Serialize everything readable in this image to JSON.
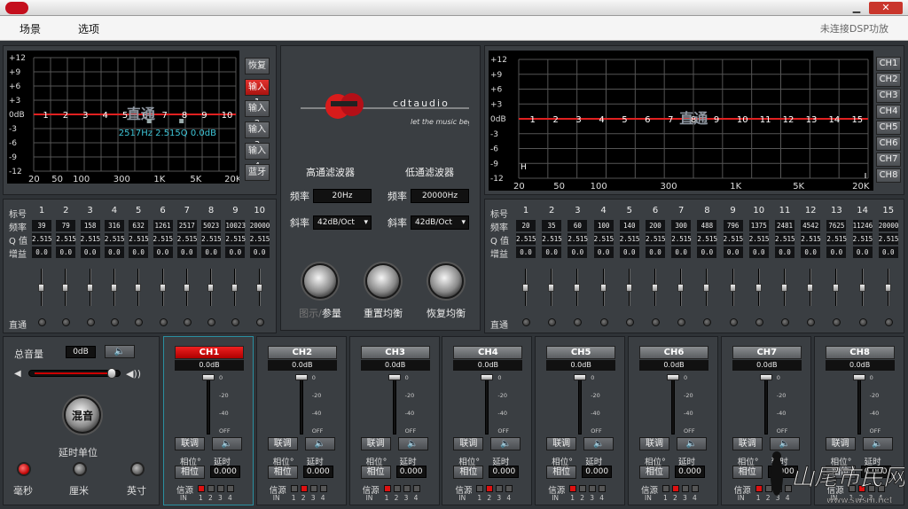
{
  "menu": {
    "items": [
      "场景",
      "选项"
    ],
    "status": "未连接DSP功放"
  },
  "eq_left": {
    "y_labels": [
      "+12",
      "+9",
      "+6",
      "+3",
      "0dB",
      "-3",
      "-6",
      "-9",
      "-12"
    ],
    "x_labels": [
      "20",
      "50",
      "100",
      "300",
      "1K",
      "5K",
      "20K"
    ],
    "band_markers": [
      "1",
      "2",
      "3",
      "4",
      "5",
      "6",
      "7",
      "8",
      "9",
      "10"
    ],
    "bypass_overlay": "直通",
    "readout": "2517Hz 2.515Q 0.0dB",
    "side_buttons": [
      "恢复",
      "输入1",
      "输入2",
      "输入3",
      "输入4",
      "蓝牙"
    ],
    "active_side": 1,
    "row_labels": [
      "标号",
      "频率",
      "Q 值",
      "增益"
    ],
    "bands": [
      "1",
      "2",
      "3",
      "4",
      "5",
      "6",
      "7",
      "8",
      "9",
      "10"
    ],
    "freqs": [
      "39",
      "79",
      "158",
      "316",
      "632",
      "1261",
      "2517",
      "5023",
      "10023",
      "20000"
    ],
    "q": [
      "2.515",
      "2.515",
      "2.515",
      "2.515",
      "2.515",
      "2.515",
      "2.515",
      "2.515",
      "2.515",
      "2.515"
    ],
    "gain": [
      "0.0",
      "0.0",
      "0.0",
      "0.0",
      "0.0",
      "0.0",
      "0.0",
      "0.0",
      "0.0",
      "0.0"
    ],
    "bypass_label": "直通"
  },
  "eq_right": {
    "y_labels": [
      "+12",
      "+9",
      "+6",
      "+3",
      "0dB",
      "-3",
      "-6",
      "-9",
      "-12"
    ],
    "x_labels": [
      "20",
      "50",
      "100",
      "300",
      "1K",
      "5K",
      "20K"
    ],
    "band_markers": [
      "1",
      "2",
      "3",
      "4",
      "5",
      "6",
      "7",
      "8",
      "9",
      "10",
      "11",
      "12",
      "13",
      "14",
      "15"
    ],
    "bypass_overlay": "直通",
    "channels": [
      "CH1",
      "CH2",
      "CH3",
      "CH4",
      "CH5",
      "CH6",
      "CH7",
      "CH8"
    ],
    "row_labels": [
      "标号",
      "频率",
      "Q 值",
      "增益"
    ],
    "bands": [
      "1",
      "2",
      "3",
      "4",
      "5",
      "6",
      "7",
      "8",
      "9",
      "10",
      "11",
      "12",
      "13",
      "14",
      "15"
    ],
    "freqs": [
      "20",
      "35",
      "60",
      "100",
      "140",
      "200",
      "300",
      "488",
      "796",
      "1375",
      "2481",
      "4542",
      "7625",
      "11246",
      "20000"
    ],
    "q": [
      "2.515",
      "2.515",
      "2.515",
      "2.515",
      "2.515",
      "2.515",
      "2.515",
      "2.515",
      "2.515",
      "2.515",
      "2.515",
      "2.515",
      "2.515",
      "2.515",
      "2.515"
    ],
    "gain": [
      "0.0",
      "0.0",
      "0.0",
      "0.0",
      "0.0",
      "0.0",
      "0.0",
      "0.0",
      "0.0",
      "0.0",
      "0.0",
      "0.0",
      "0.0",
      "0.0",
      "0.0"
    ],
    "bypass_label": "直通"
  },
  "center": {
    "brand": "cdtaudio",
    "slogan": "let the music begin",
    "hp_title": "高通滤波器",
    "lp_title": "低通滤波器",
    "freq_label": "频率",
    "slope_label": "斜率",
    "hp_freq": "20Hz",
    "lp_freq": "20000Hz",
    "hp_slope": "42dB/Oct",
    "lp_slope": "42dB/Oct",
    "knob_view_a": "图示",
    "knob_view_sep": "/",
    "knob_view_b": "参量",
    "knob_reset": "重置均衡",
    "knob_restore": "恢复均衡"
  },
  "master": {
    "title": "总音量",
    "volume": "0dB",
    "mix": "混音",
    "delay_unit": "延时单位",
    "units": [
      "毫秒",
      "厘米",
      "英寸"
    ],
    "active_unit": 0
  },
  "channels": [
    {
      "name": "CH1",
      "level": "0.0dB",
      "active": true,
      "src": 1
    },
    {
      "name": "CH2",
      "level": "0.0dB",
      "active": false,
      "src": 2
    },
    {
      "name": "CH3",
      "level": "0.0dB",
      "active": false,
      "src": 1
    },
    {
      "name": "CH4",
      "level": "0.0dB",
      "active": false,
      "src": 2
    },
    {
      "name": "CH5",
      "level": "0.0dB",
      "active": false,
      "src": 1
    },
    {
      "name": "CH6",
      "level": "0.0dB",
      "active": false,
      "src": 2
    },
    {
      "name": "CH7",
      "level": "0.0dB",
      "active": false,
      "src": 1
    },
    {
      "name": "CH8",
      "level": "0.0dB",
      "active": false,
      "src": 2
    }
  ],
  "channel_labels": {
    "link": "联调",
    "phase": "相位°",
    "delay": "延时",
    "phase_btn": "相位",
    "delay_val": "0.000",
    "source": "信源",
    "src_in": "IN",
    "src_nums": [
      "1",
      "2",
      "3",
      "4"
    ],
    "scale": [
      "0",
      "-20",
      "-40",
      "OFF"
    ]
  },
  "watermark": {
    "text": "山尾市民网",
    "url": "www.swsm.net"
  },
  "colors": {
    "accent_red": "#e3322e",
    "cyan_readout": "#3fc6d8",
    "graph_line": "#e02020"
  }
}
